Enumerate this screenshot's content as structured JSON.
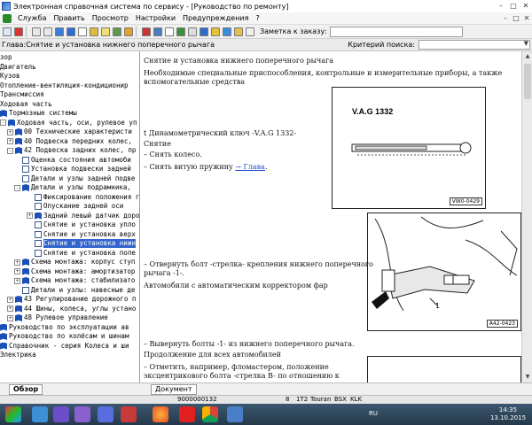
{
  "window": {
    "title": "Электронная справочная система по сервису - [Руководство по ремонту]",
    "buttons": [
      "–",
      "□",
      "✕"
    ]
  },
  "menu": {
    "items": [
      "Служба",
      "Править",
      "Просмотр",
      "Настройки",
      "Предупреждения",
      "?"
    ],
    "mdi_buttons": [
      "–",
      "□",
      "✕"
    ]
  },
  "toolbar": {
    "order_label": "Заметка к заказу:"
  },
  "chapter": {
    "text": "Глава:Снятие и установка нижнего поперечного рычага",
    "criterion_label": "Критерий  поиска:"
  },
  "tree": {
    "items": [
      {
        "label": "зор",
        "level": 0,
        "icon": "none",
        "exp": ""
      },
      {
        "label": "Двигатель",
        "level": 0,
        "icon": "none",
        "exp": ""
      },
      {
        "label": "Кузов",
        "level": 0,
        "icon": "none",
        "exp": ""
      },
      {
        "label": "Отопление-вентиляция-кондиционир",
        "level": 0,
        "icon": "none",
        "exp": ""
      },
      {
        "label": "Трансмиссия",
        "level": 0,
        "icon": "none",
        "exp": ""
      },
      {
        "label": "Ходовая часть",
        "level": 0,
        "icon": "none",
        "exp": ""
      },
      {
        "label": "Тормозные системы",
        "level": 0,
        "icon": "book",
        "exp": ""
      },
      {
        "label": "Ходовая часть, оси, рулевое уп",
        "level": 0,
        "icon": "book",
        "exp": "-"
      },
      {
        "label": "00 Технические характеристи",
        "level": 1,
        "icon": "book",
        "exp": "+"
      },
      {
        "label": "40 Подвеска передних колес,",
        "level": 1,
        "icon": "book",
        "exp": "+"
      },
      {
        "label": "42 Подвеска задних колес, пр",
        "level": 1,
        "icon": "book",
        "exp": "-"
      },
      {
        "label": "Оценка состояния автомоби",
        "level": 2,
        "icon": "doc",
        "exp": ""
      },
      {
        "label": "Установка подвески задней",
        "level": 2,
        "icon": "doc",
        "exp": ""
      },
      {
        "label": "Детали и узлы задней подве",
        "level": 2,
        "icon": "doc",
        "exp": ""
      },
      {
        "label": "Детали и узлы подрамника,",
        "level": 2,
        "icon": "book",
        "exp": "-"
      },
      {
        "label": "Фиксирование положения г",
        "level": 3,
        "icon": "doc",
        "exp": ""
      },
      {
        "label": "Опускание задней оси",
        "level": 3,
        "icon": "doc",
        "exp": ""
      },
      {
        "label": "Задний левый датчик доро",
        "level": 3,
        "icon": "book",
        "exp": "+"
      },
      {
        "label": "Снятие и установка упло",
        "level": 3,
        "icon": "doc",
        "exp": ""
      },
      {
        "label": "Снятие и установка верх",
        "level": 3,
        "icon": "doc",
        "exp": ""
      },
      {
        "label": "Снятие и установка нижн",
        "level": 3,
        "icon": "doc",
        "exp": "",
        "selected": true
      },
      {
        "label": "Снятие и установка попе",
        "level": 3,
        "icon": "doc",
        "exp": ""
      },
      {
        "label": "Схема монтажа: корпус ступ",
        "level": 2,
        "icon": "book",
        "exp": "+"
      },
      {
        "label": "Схема монтажа: амортизатор",
        "level": 2,
        "icon": "book",
        "exp": "+"
      },
      {
        "label": "Схема монтажа: стабилизато",
        "level": 2,
        "icon": "book",
        "exp": "+"
      },
      {
        "label": "Детали и узлы: навесные де",
        "level": 2,
        "icon": "doc",
        "exp": ""
      },
      {
        "label": "43 Регулирование дорожного п",
        "level": 1,
        "icon": "book",
        "exp": "+"
      },
      {
        "label": "44 Шины, колеса, углы устано",
        "level": 1,
        "icon": "book",
        "exp": "+"
      },
      {
        "label": "48 Рулевое управление",
        "level": 1,
        "icon": "book",
        "exp": "+"
      },
      {
        "label": "Руководство по эксплуатации ав",
        "level": 0,
        "icon": "book",
        "exp": ""
      },
      {
        "label": "Руководство по колёсам и шинам",
        "level": 0,
        "icon": "book",
        "exp": ""
      },
      {
        "label": "Справочник - серия Колеса и ши",
        "level": 0,
        "icon": "book",
        "exp": ""
      },
      {
        "label": "Электрика",
        "level": 0,
        "icon": "none",
        "exp": ""
      }
    ],
    "tab_label": "Обзор"
  },
  "document": {
    "heading": "Снятие и установка нижнего поперечного рычага",
    "intro_1": "Необходимые специальные приспособления, контрольные и измерительные приборы, а также",
    "intro_2": "вспомогательные средства",
    "tool_line": "t  Динамометрический ключ -V.A.G 1332-",
    "removal_heading": "Снятие",
    "step_wheel": "–  Снять колесо.",
    "step_spring_text": "–  Снять витую пружину ",
    "step_spring_link": "→ Глава",
    "step_spring_end": ".",
    "step_bolt_1": "–  Отвернуть болт -стрелка- крепления нижнего поперечного",
    "step_bolt_2": "    рычага -1-.",
    "auto_corrector": "Автомобили с автоматическим корректором фар",
    "step_bolts_1": "–  Вывернуть болты -1- из нижнего поперечного рычага.",
    "continue_all": "Продолжение для всех автомобилей",
    "step_mark_1": "–  Отметить, например, фломастером, положение",
    "step_mark_2": "    эксцентрикового болта -стрелка B- по отношению к",
    "figure_1_title": "V.A.G 1332",
    "figure_1_code": "VW0-0429",
    "figure_2_label": "1",
    "figure_2_code": "A42-0423",
    "tab_label": "Документ"
  },
  "status": {
    "code": "9000000132",
    "cells": [
      "8",
      "1T2",
      "Touran",
      "BSX",
      "KLK"
    ]
  },
  "taskbar": {
    "lang": "RU",
    "time": "14:35",
    "date": "13.10.2015"
  }
}
